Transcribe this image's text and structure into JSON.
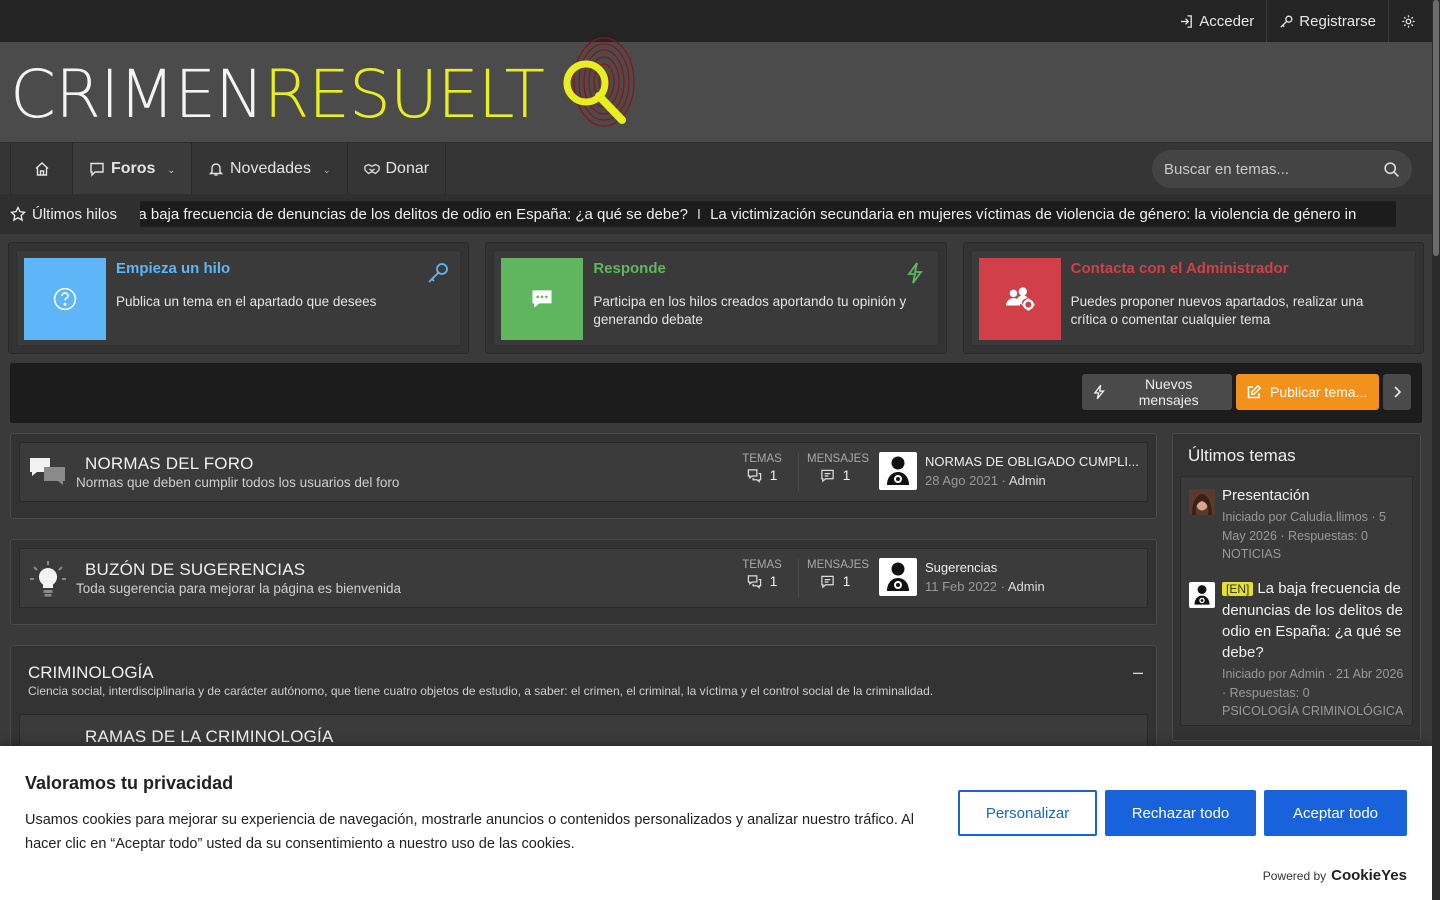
{
  "topbar": {
    "login_label": "Acceder",
    "register_label": "Registrarse"
  },
  "logo": {
    "part_white": "CRIMEN",
    "part_yellow": "RESUELT"
  },
  "nav": {
    "forums_label": "Foros",
    "news_label": "Novedades",
    "donate_label": "Donar",
    "search_placeholder": "Buscar en temas..."
  },
  "ticker": {
    "label": "Últimos hilos",
    "items": [
      "La baja frecuencia de denuncias de los delitos de odio en España: ¿a qué se debe?",
      "La victimización secundaria en mujeres víctimas de violencia de género: la violencia de género in"
    ],
    "separator": "I"
  },
  "promos": [
    {
      "title": "Empieza un hilo",
      "desc": "Publica un tema en el apartado que desees",
      "color": "#5eb5f7"
    },
    {
      "title": "Responde",
      "desc": "Participa en los hilos creados aportando tu opinión y generando debate",
      "color": "#5fb65f"
    },
    {
      "title": "Contacta con el Administrador",
      "desc": "Puedes proponer nuevos apartados, realizar una crítica o comentar cualquier tema",
      "color": "#d13f48"
    }
  ],
  "actions": {
    "new_posts": "Nuevos mensajes",
    "post_thread": "Publicar tema..."
  },
  "forums": [
    {
      "title": "NORMAS DEL FORO",
      "desc": "Normas que deben cumplir todos los usuarios del foro",
      "threads_label": "TEMAS",
      "threads": "1",
      "posts_label": "MENSAJES",
      "posts": "1",
      "last_title": "NORMAS DE OBLIGADO CUMPLI...",
      "last_date": "28 Ago 2021",
      "last_user": "Admin"
    },
    {
      "title": "BUZÓN DE SUGERENCIAS",
      "desc": "Toda sugerencia para mejorar la página es bienvenida",
      "threads_label": "TEMAS",
      "threads": "1",
      "posts_label": "MENSAJES",
      "posts": "1",
      "last_title": "Sugerencias",
      "last_date": "11 Feb 2022",
      "last_user": "Admin"
    }
  ],
  "category": {
    "title": "CRIMINOLOGÍA",
    "desc": "Ciencia social, interdisciplinaria y de carácter autónomo, que tiene cuatro objetos de estudio, a saber: el crimen, el criminal, la víctima y el control social de la criminalidad.",
    "collapse": "–",
    "first_node": "RAMAS DE LA CRIMINOLOGÍA"
  },
  "sidebar": {
    "title": "Últimos temas",
    "items": [
      {
        "title": "Presentación",
        "meta": "Iniciado por Caludia.llimos · 5 May 2026 · Respuestas: 0",
        "forum": "NOTICIAS"
      },
      {
        "tag": "[EN]",
        "title": "La baja frecuencia de denuncias de los delitos de odio en España: ¿a qué se debe?",
        "meta": "Iniciado por Admin · 21 Abr 2026 · Respuestas: 0",
        "forum": "PSICOLOGÍA CRIMINOLÓGICA"
      }
    ]
  },
  "cookie": {
    "title": "Valoramos tu privacidad",
    "text": "Usamos cookies para mejorar su experiencia de navegación, mostrarle anuncios o contenidos personalizados y analizar nuestro tráfico. Al hacer clic en “Aceptar todo” usted da su consentimiento a nuestro uso de las cookies.",
    "customize": "Personalizar",
    "reject": "Rechazar todo",
    "accept": "Aceptar todo",
    "powered": "Powered by",
    "brand": "CookieYes"
  }
}
